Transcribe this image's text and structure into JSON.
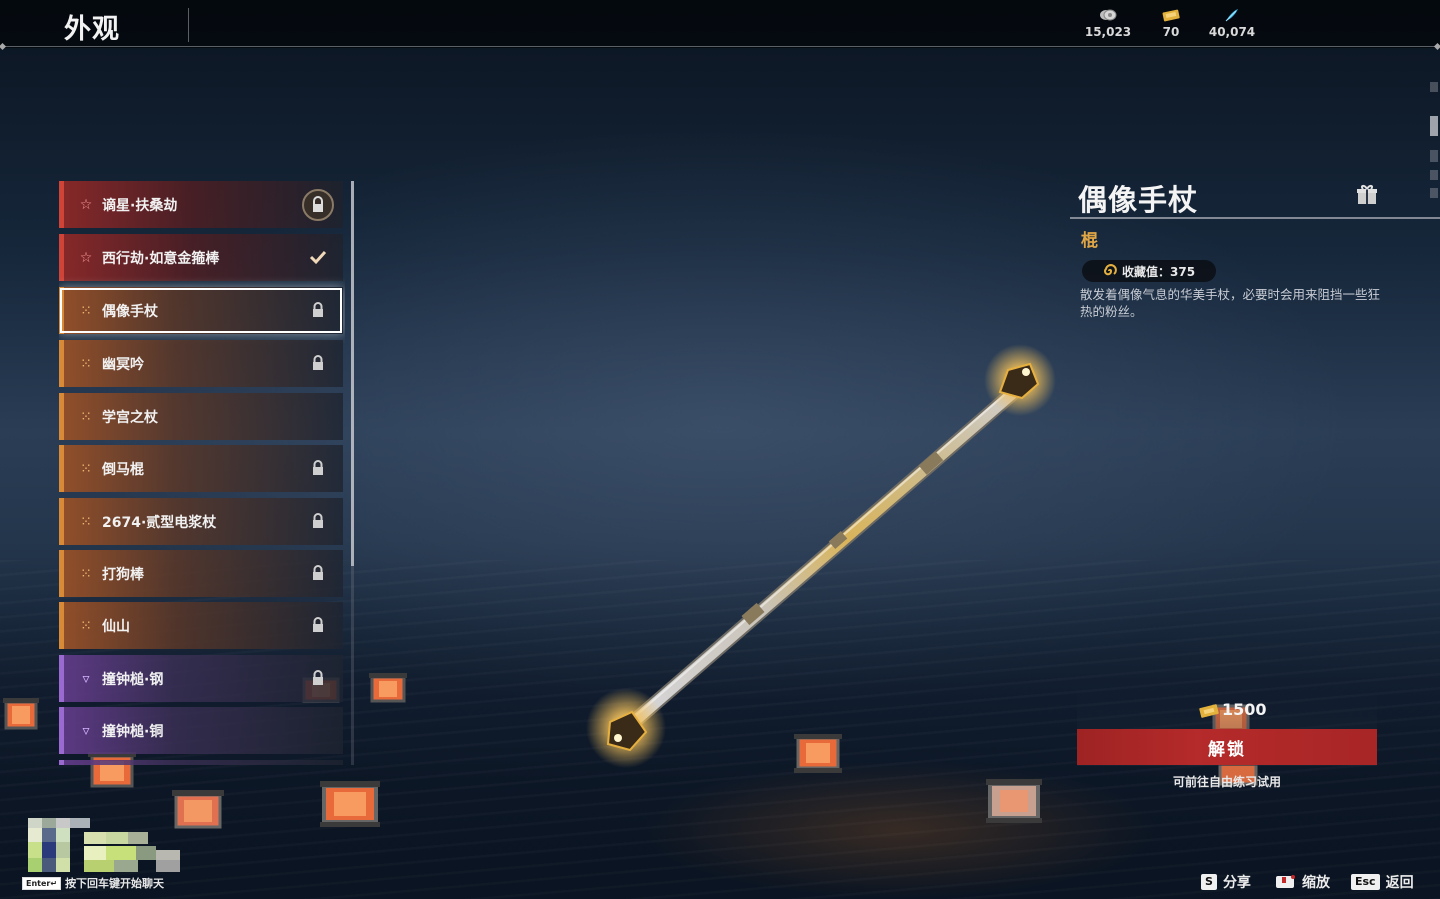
{
  "topbar": {
    "title": "外观",
    "currencies": [
      {
        "icon": "silver-coin-icon",
        "value": "15,023",
        "color": "#c9c9c9"
      },
      {
        "icon": "gold-ticket-icon",
        "value": "70",
        "color": "#e2b13c"
      },
      {
        "icon": "blue-feather-icon",
        "value": "40,074",
        "color": "#3fb8e6"
      }
    ]
  },
  "list": {
    "items": [
      {
        "label": "谪星·扶桑劫",
        "quality": "red",
        "quality_icon": "star-outline-icon",
        "status": "locked-badge"
      },
      {
        "label": "西行劫·如意金箍棒",
        "quality": "red",
        "quality_icon": "star-outline-icon",
        "status": "equipped-check"
      },
      {
        "label": "偶像手杖",
        "quality": "orange",
        "quality_icon": "dot-cluster-icon",
        "status": "locked",
        "selected": true
      },
      {
        "label": "幽冥吟",
        "quality": "orange",
        "quality_icon": "dot-cluster-icon",
        "status": "locked"
      },
      {
        "label": "学宫之杖",
        "quality": "orange",
        "quality_icon": "dot-cluster-icon",
        "status": "none"
      },
      {
        "label": "倒马棍",
        "quality": "orange",
        "quality_icon": "dot-cluster-icon",
        "status": "locked"
      },
      {
        "label": "2674·贰型电浆杖",
        "quality": "orange",
        "quality_icon": "dot-cluster-icon",
        "status": "locked"
      },
      {
        "label": "打狗棒",
        "quality": "orange",
        "quality_icon": "dot-cluster-icon",
        "status": "locked"
      },
      {
        "label": "仙山",
        "quality": "orange",
        "quality_icon": "dot-cluster-icon",
        "status": "locked"
      },
      {
        "label": "撞钟槌·钢",
        "quality": "purple",
        "quality_icon": "triangle-dots-icon",
        "status": "locked"
      },
      {
        "label": "撞钟槌·铜",
        "quality": "purple",
        "quality_icon": "triangle-dots-icon",
        "status": "none"
      }
    ]
  },
  "detail": {
    "title": "偶像手杖",
    "type": "棍",
    "collection_label": "收藏值：375",
    "description": "散发着偶像气息的华美手杖，必要时会用来阻挡一些狂热的粉丝。"
  },
  "unlock": {
    "price": "1500",
    "button_label": "解锁",
    "trial_text": "可前往自由练习试用"
  },
  "hints": {
    "chat_key": "Enter↵",
    "chat_text": "按下回车键开始聊天",
    "share_key": "S",
    "share_label": "分享",
    "zoom_label": "缩放",
    "back_key": "Esc",
    "back_label": "返回"
  },
  "colors": {
    "red_quality": "#d04438",
    "orange_quality": "#d98a36",
    "purple_quality": "#9a6ad0",
    "unlock_red": "#b52a2a",
    "type_gold": "#e0a645"
  }
}
